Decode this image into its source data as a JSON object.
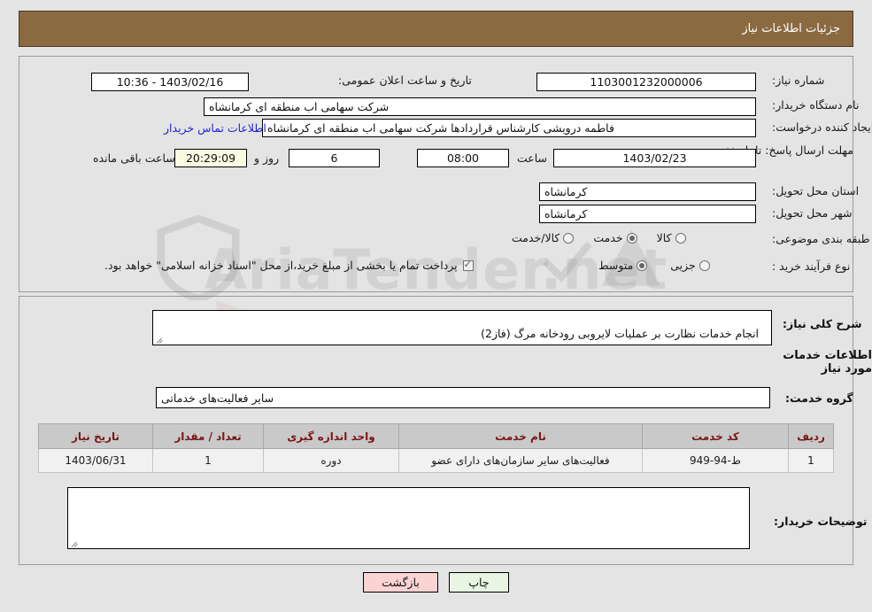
{
  "header": {
    "title": "جزئیات اطلاعات نیاز"
  },
  "watermark": {
    "text": "AriaTender.net"
  },
  "form": {
    "need_number": {
      "label": "شماره نیاز:",
      "value": "1103001232000006"
    },
    "announce_datetime": {
      "label": "تاریخ و ساعت اعلان عمومی:",
      "value": "1403/02/16 - 10:36"
    },
    "buyer_org": {
      "label": "نام دستگاه خریدار:",
      "value": "شرکت سهامی اب منطقه ای کرمانشاه"
    },
    "request_creator": {
      "label": "ایجاد کننده درخواست:",
      "value": "فاطمه درویشی کارشناس قراردادها شرکت سهامی اب منطقه ای کرمانشاه"
    },
    "contact_link": "اطلاعات تماس خریدار",
    "deadline": {
      "label": "مهلت ارسال پاسخ: تا تاریخ:",
      "date": "1403/02/23",
      "time_label": "ساعت",
      "time": "08:00",
      "days": "6",
      "days_label": "روز و",
      "countdown": "20:29:09",
      "countdown_label": "ساعت باقی مانده"
    },
    "delivery_province": {
      "label": "استان محل تحویل:",
      "value": "کرمانشاه"
    },
    "delivery_city": {
      "label": "شهر محل تحویل:",
      "value": "کرمانشاه"
    },
    "subject_category": {
      "label": "طبقه بندی موضوعی:",
      "options": [
        {
          "label": "کالا",
          "selected": false
        },
        {
          "label": "خدمت",
          "selected": true
        },
        {
          "label": "کالا/خدمت",
          "selected": false
        }
      ]
    },
    "process_type": {
      "label": "نوع فرآیند خرید :",
      "options": [
        {
          "label": "جزیی",
          "selected": false
        },
        {
          "label": "متوسط",
          "selected": true
        }
      ],
      "treasury_checkbox": {
        "checked": true,
        "text": "پرداخت تمام یا بخشی از مبلغ خرید،از محل \"اسناد خزانه اسلامی\" خواهد بود."
      }
    }
  },
  "need_summary": {
    "label": "شرح کلی نیاز:",
    "value": "انجام خدمات نظارت بر عملیات لایروبی رودخانه مرگ (فاز2)"
  },
  "services_section": {
    "heading": "اطلاعات خدمات مورد نیاز",
    "service_group": {
      "label": "گروه خدمت:",
      "value": "سایر فعالیت‌های خدماتی"
    }
  },
  "table": {
    "columns": [
      "ردیف",
      "کد خدمت",
      "نام خدمت",
      "واحد اندازه گیری",
      "تعداد / مقدار",
      "تاریخ نیاز"
    ],
    "rows": [
      {
        "radif": "1",
        "code": "ط-94-949",
        "name": "فعالیت‌های سایر سازمان‌های دارای عضو",
        "unit": "دوره",
        "qty": "1",
        "date": "1403/06/31"
      }
    ]
  },
  "buyer_notes": {
    "label": "توضیحات خریدار:",
    "value": ""
  },
  "buttons": {
    "back": "بازگشت",
    "print": "چاپ"
  },
  "colors": {
    "header_bg": "#8b6a42",
    "link": "#2323d6",
    "table_header_text": "#7a1515",
    "back_btn": "#fbd3d3",
    "print_btn": "#e8f5e3",
    "countdown_bg": "#fbfbe4"
  }
}
